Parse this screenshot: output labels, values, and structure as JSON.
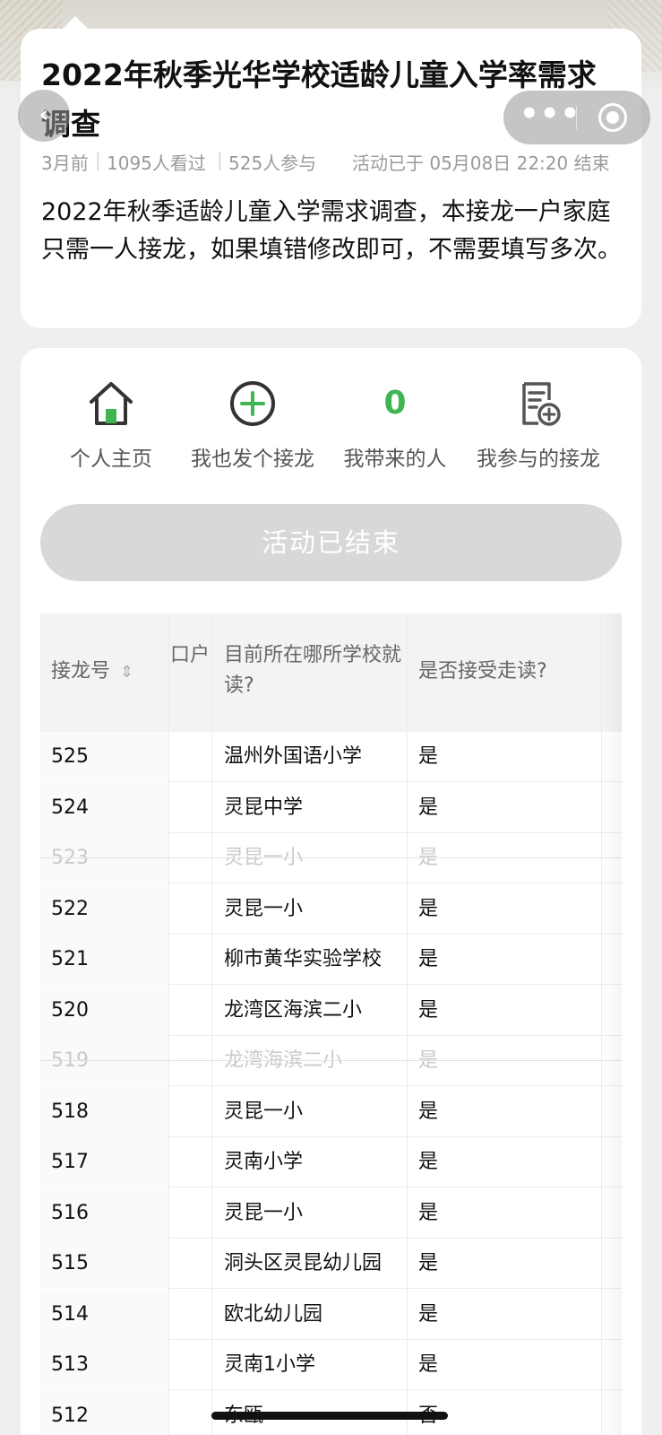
{
  "header": {
    "title": "2022年秋季光华学校适龄儿童入学率需求调查",
    "time_ago": "3月前",
    "views": "1095人看过",
    "participants": "525人参与",
    "end_info": "活动已于 05月08日 22:20 结束",
    "description": "2022年秋季适龄儿童入学需求调查，本接龙一户家庭只需一人接龙，如果填错修改即可，不需要填写多次。"
  },
  "nav": {
    "back_icon": "chevron-left-icon",
    "more_icon": "more-dots-icon",
    "close_icon": "target-circle-icon"
  },
  "actions": [
    {
      "label": "个人主页",
      "icon": "home-icon"
    },
    {
      "label": "我也发个接龙",
      "icon": "plus-circle-icon"
    },
    {
      "label": "我带来的人",
      "count": "0"
    },
    {
      "label": "我参与的接龙",
      "icon": "document-add-icon"
    }
  ],
  "status_button": "活动已结束",
  "table": {
    "headers": [
      "接龙号",
      "口户",
      "目前所在哪所学校就读?",
      "是否接受走读?"
    ],
    "rows": [
      {
        "id": "525",
        "school": "温州外国语小学",
        "accept": "是",
        "dim": false
      },
      {
        "id": "524",
        "school": "灵昆中学",
        "accept": "是",
        "dim": false
      },
      {
        "id": "523",
        "school": "灵昆一小",
        "accept": "是",
        "dim": true
      },
      {
        "id": "522",
        "school": "灵昆一小",
        "accept": "是",
        "dim": false
      },
      {
        "id": "521",
        "school": "柳市黄华实验学校",
        "accept": "是",
        "dim": false
      },
      {
        "id": "520",
        "school": "龙湾区海滨二小",
        "accept": "是",
        "dim": false
      },
      {
        "id": "519",
        "school": "龙湾海滨二小",
        "accept": "是",
        "dim": true
      },
      {
        "id": "518",
        "school": "灵昆一小",
        "accept": "是",
        "dim": false
      },
      {
        "id": "517",
        "school": "灵南小学",
        "accept": "是",
        "dim": false
      },
      {
        "id": "516",
        "school": "灵昆一小",
        "accept": "是",
        "dim": false
      },
      {
        "id": "515",
        "school": "洞头区灵昆幼儿园",
        "accept": "是",
        "dim": false
      },
      {
        "id": "514",
        "school": "欧北幼儿园",
        "accept": "是",
        "dim": false
      },
      {
        "id": "513",
        "school": "灵南1小学",
        "accept": "是",
        "dim": false
      },
      {
        "id": "512",
        "school": "东瓯",
        "accept": "否",
        "dim": false
      }
    ]
  },
  "colors": {
    "accent_green": "#3eb551",
    "muted": "#9a9a9a",
    "button_disabled": "#d8d8d8"
  }
}
